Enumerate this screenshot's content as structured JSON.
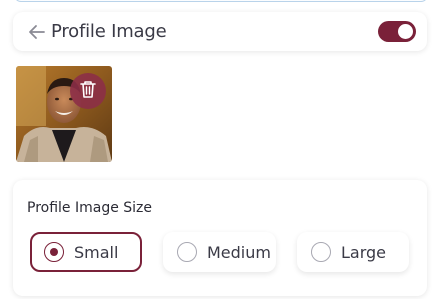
{
  "header": {
    "title": "Profile Image",
    "toggle_on": true
  },
  "profile_size": {
    "label": "Profile Image Size",
    "options": [
      {
        "label": "Small",
        "selected": true
      },
      {
        "label": "Medium",
        "selected": false
      },
      {
        "label": "Large",
        "selected": false
      }
    ]
  },
  "colors": {
    "accent": "#7a2139",
    "text": "#3a3a46"
  },
  "icons": {
    "back": "arrow-left-icon",
    "delete": "trash-icon"
  }
}
